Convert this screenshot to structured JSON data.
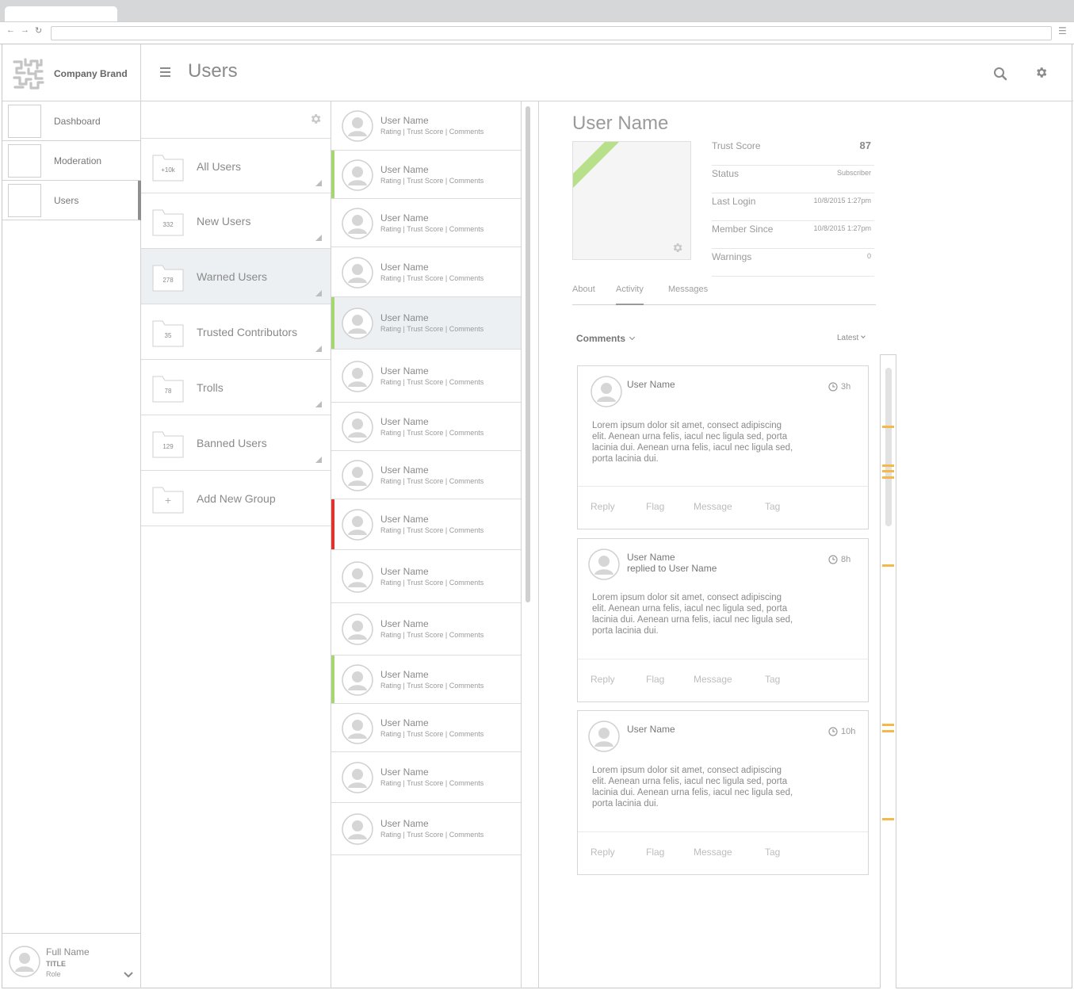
{
  "browser": {
    "back": "←",
    "forward": "→",
    "reload": "↻",
    "menu": "☰"
  },
  "brand": {
    "name": "Company Brand"
  },
  "nav": [
    {
      "label": "Dashboard"
    },
    {
      "label": "Moderation"
    },
    {
      "label": "Users",
      "active": true
    }
  ],
  "header": {
    "title": "Users",
    "menu_icon": "hamburger-icon",
    "search_icon": "search-icon",
    "settings_icon": "gear-icon"
  },
  "groups": [
    {
      "count": "+10k",
      "label": "All Users"
    },
    {
      "count": "332",
      "label": "New Users"
    },
    {
      "count": "278",
      "label": "Warned Users",
      "selected": true
    },
    {
      "count": "35",
      "label": "Trusted Contributors"
    },
    {
      "count": "78",
      "label": "Trolls"
    },
    {
      "count": "129",
      "label": "Banned Users"
    },
    {
      "count": "+",
      "label": "Add New Group"
    }
  ],
  "users": [
    {
      "name": "User Name",
      "meta": "Rating | Trust Score | Comments",
      "flag": ""
    },
    {
      "name": "User Name",
      "meta": "Rating | Trust Score | Comments",
      "flag": "#a6d670"
    },
    {
      "name": "User Name",
      "meta": "Rating | Trust Score | Comments",
      "flag": ""
    },
    {
      "name": "User Name",
      "meta": "Rating | Trust Score | Comments",
      "flag": ""
    },
    {
      "name": "User Name",
      "meta": "Rating | Trust Score | Comments",
      "flag": "#a6d670",
      "selected": true
    },
    {
      "name": "User Name",
      "meta": "Rating | Trust Score | Comments",
      "flag": ""
    },
    {
      "name": "User Name",
      "meta": "Rating | Trust Score | Comments",
      "flag": ""
    },
    {
      "name": "User Name",
      "meta": "Rating | Trust Score | Comments",
      "flag": ""
    },
    {
      "name": "User Name",
      "meta": "Rating | Trust Score | Comments",
      "flag": "#e0332d"
    },
    {
      "name": "User Name",
      "meta": "Rating | Trust Score | Comments",
      "flag": ""
    },
    {
      "name": "User Name",
      "meta": "Rating | Trust Score | Comments",
      "flag": ""
    },
    {
      "name": "User Name",
      "meta": "Rating | Trust Score | Comments",
      "flag": "#a6d670"
    },
    {
      "name": "User Name",
      "meta": "Rating | Trust Score | Comments",
      "flag": ""
    },
    {
      "name": "User Name",
      "meta": "Rating | Trust Score | Comments",
      "flag": ""
    },
    {
      "name": "User Name",
      "meta": "Rating | Trust Score | Comments",
      "flag": ""
    }
  ],
  "detail": {
    "name": "User Name",
    "stats": [
      {
        "label": "Trust Score",
        "value": "87",
        "big": true
      },
      {
        "label": "Status",
        "value": "Subscriber"
      },
      {
        "label": "Last Login",
        "value": "10/8/2015  1:27pm"
      },
      {
        "label": "Member Since",
        "value": "10/8/2015  1:27pm"
      },
      {
        "label": "Warnings",
        "value": "0"
      }
    ],
    "tabs": [
      {
        "label": "About"
      },
      {
        "label": "Activity",
        "active": true
      },
      {
        "label": "Messages"
      }
    ],
    "comments_label": "Comments",
    "sort_label": "Latest"
  },
  "comments": [
    {
      "user": "User Name",
      "reply_to": "",
      "time": "3h",
      "body": "Lorem ipsum dolor sit amet, consect adipiscing elit. Aenean urna felis, iacul nec ligula sed, porta lacinia dui. Aenean urna felis, iacul nec ligula sed, porta lacinia dui.",
      "actions": [
        "Reply",
        "Flag",
        "Message",
        "Tag"
      ]
    },
    {
      "user": "User Name",
      "reply_to": "replied to User Name",
      "time": "8h",
      "body": "Lorem ipsum dolor sit amet, consect adipiscing elit. Aenean urna felis, iacul nec ligula sed, porta lacinia dui. Aenean urna felis, iacul nec ligula sed, porta lacinia dui.",
      "actions": [
        "Reply",
        "Flag",
        "Message",
        "Tag"
      ]
    },
    {
      "user": "User Name",
      "reply_to": "",
      "time": "10h",
      "body": "Lorem ipsum dolor sit amet, consect adipiscing elit. Aenean urna felis, iacul nec ligula sed, porta lacinia dui. Aenean urna felis, iacul nec ligula sed, porta lacinia dui.",
      "actions": [
        "Reply",
        "Flag",
        "Message",
        "Tag"
      ]
    }
  ],
  "profile": {
    "name": "Full Name",
    "title": "TITLE",
    "role": "Role"
  },
  "colors": {
    "accent_green": "#a6d670",
    "flag_red": "#e0332d",
    "timeline_marker": "#f5b94a"
  }
}
